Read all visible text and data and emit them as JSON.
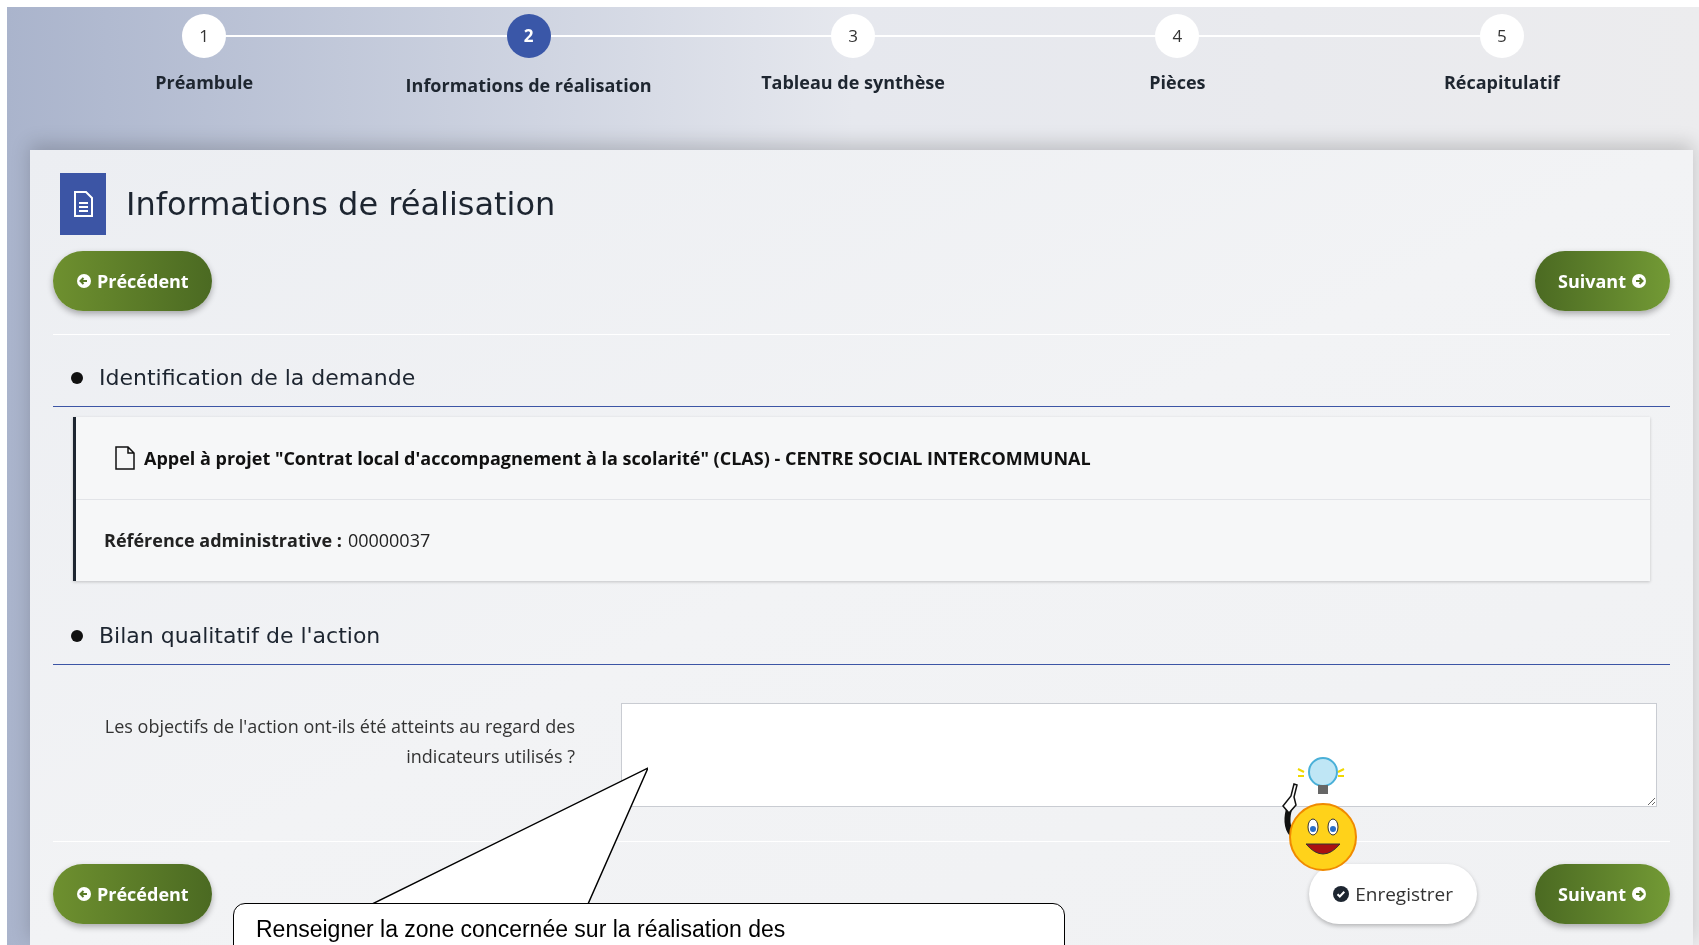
{
  "steps": [
    {
      "number": "1",
      "label": "Préambule",
      "selected": false
    },
    {
      "number": "2",
      "label": "Informations de réalisation",
      "selected": true
    },
    {
      "number": "3",
      "label": "Tableau de synthèse",
      "selected": false
    },
    {
      "number": "4",
      "label": "Pièces",
      "selected": false
    },
    {
      "number": "5",
      "label": "Récapitulatif",
      "selected": false
    }
  ],
  "page_title": "Informations de réalisation",
  "top_nav": {
    "previous": "Précédent",
    "next": "Suivant"
  },
  "identification": {
    "heading": "Identification de la demande",
    "request_title": "Appel à projet \"Contrat local d'accompagnement à la scolarité\" (CLAS) - CENTRE SOCIAL INTERCOMMUNAL",
    "reference_label": "Référence administrative :",
    "reference_value": "00000037"
  },
  "assessment": {
    "heading": "Bilan qualitatif de l'action",
    "question": "Les objectifs de l'action ont-ils été atteints au regard des indicateurs utilisés ?"
  },
  "bottom_nav": {
    "previous": "Précédent",
    "save": "Enregistrer",
    "next": "Suivant"
  },
  "callout": {
    "text": "Renseigner la zone concernée sur la réalisation des"
  }
}
